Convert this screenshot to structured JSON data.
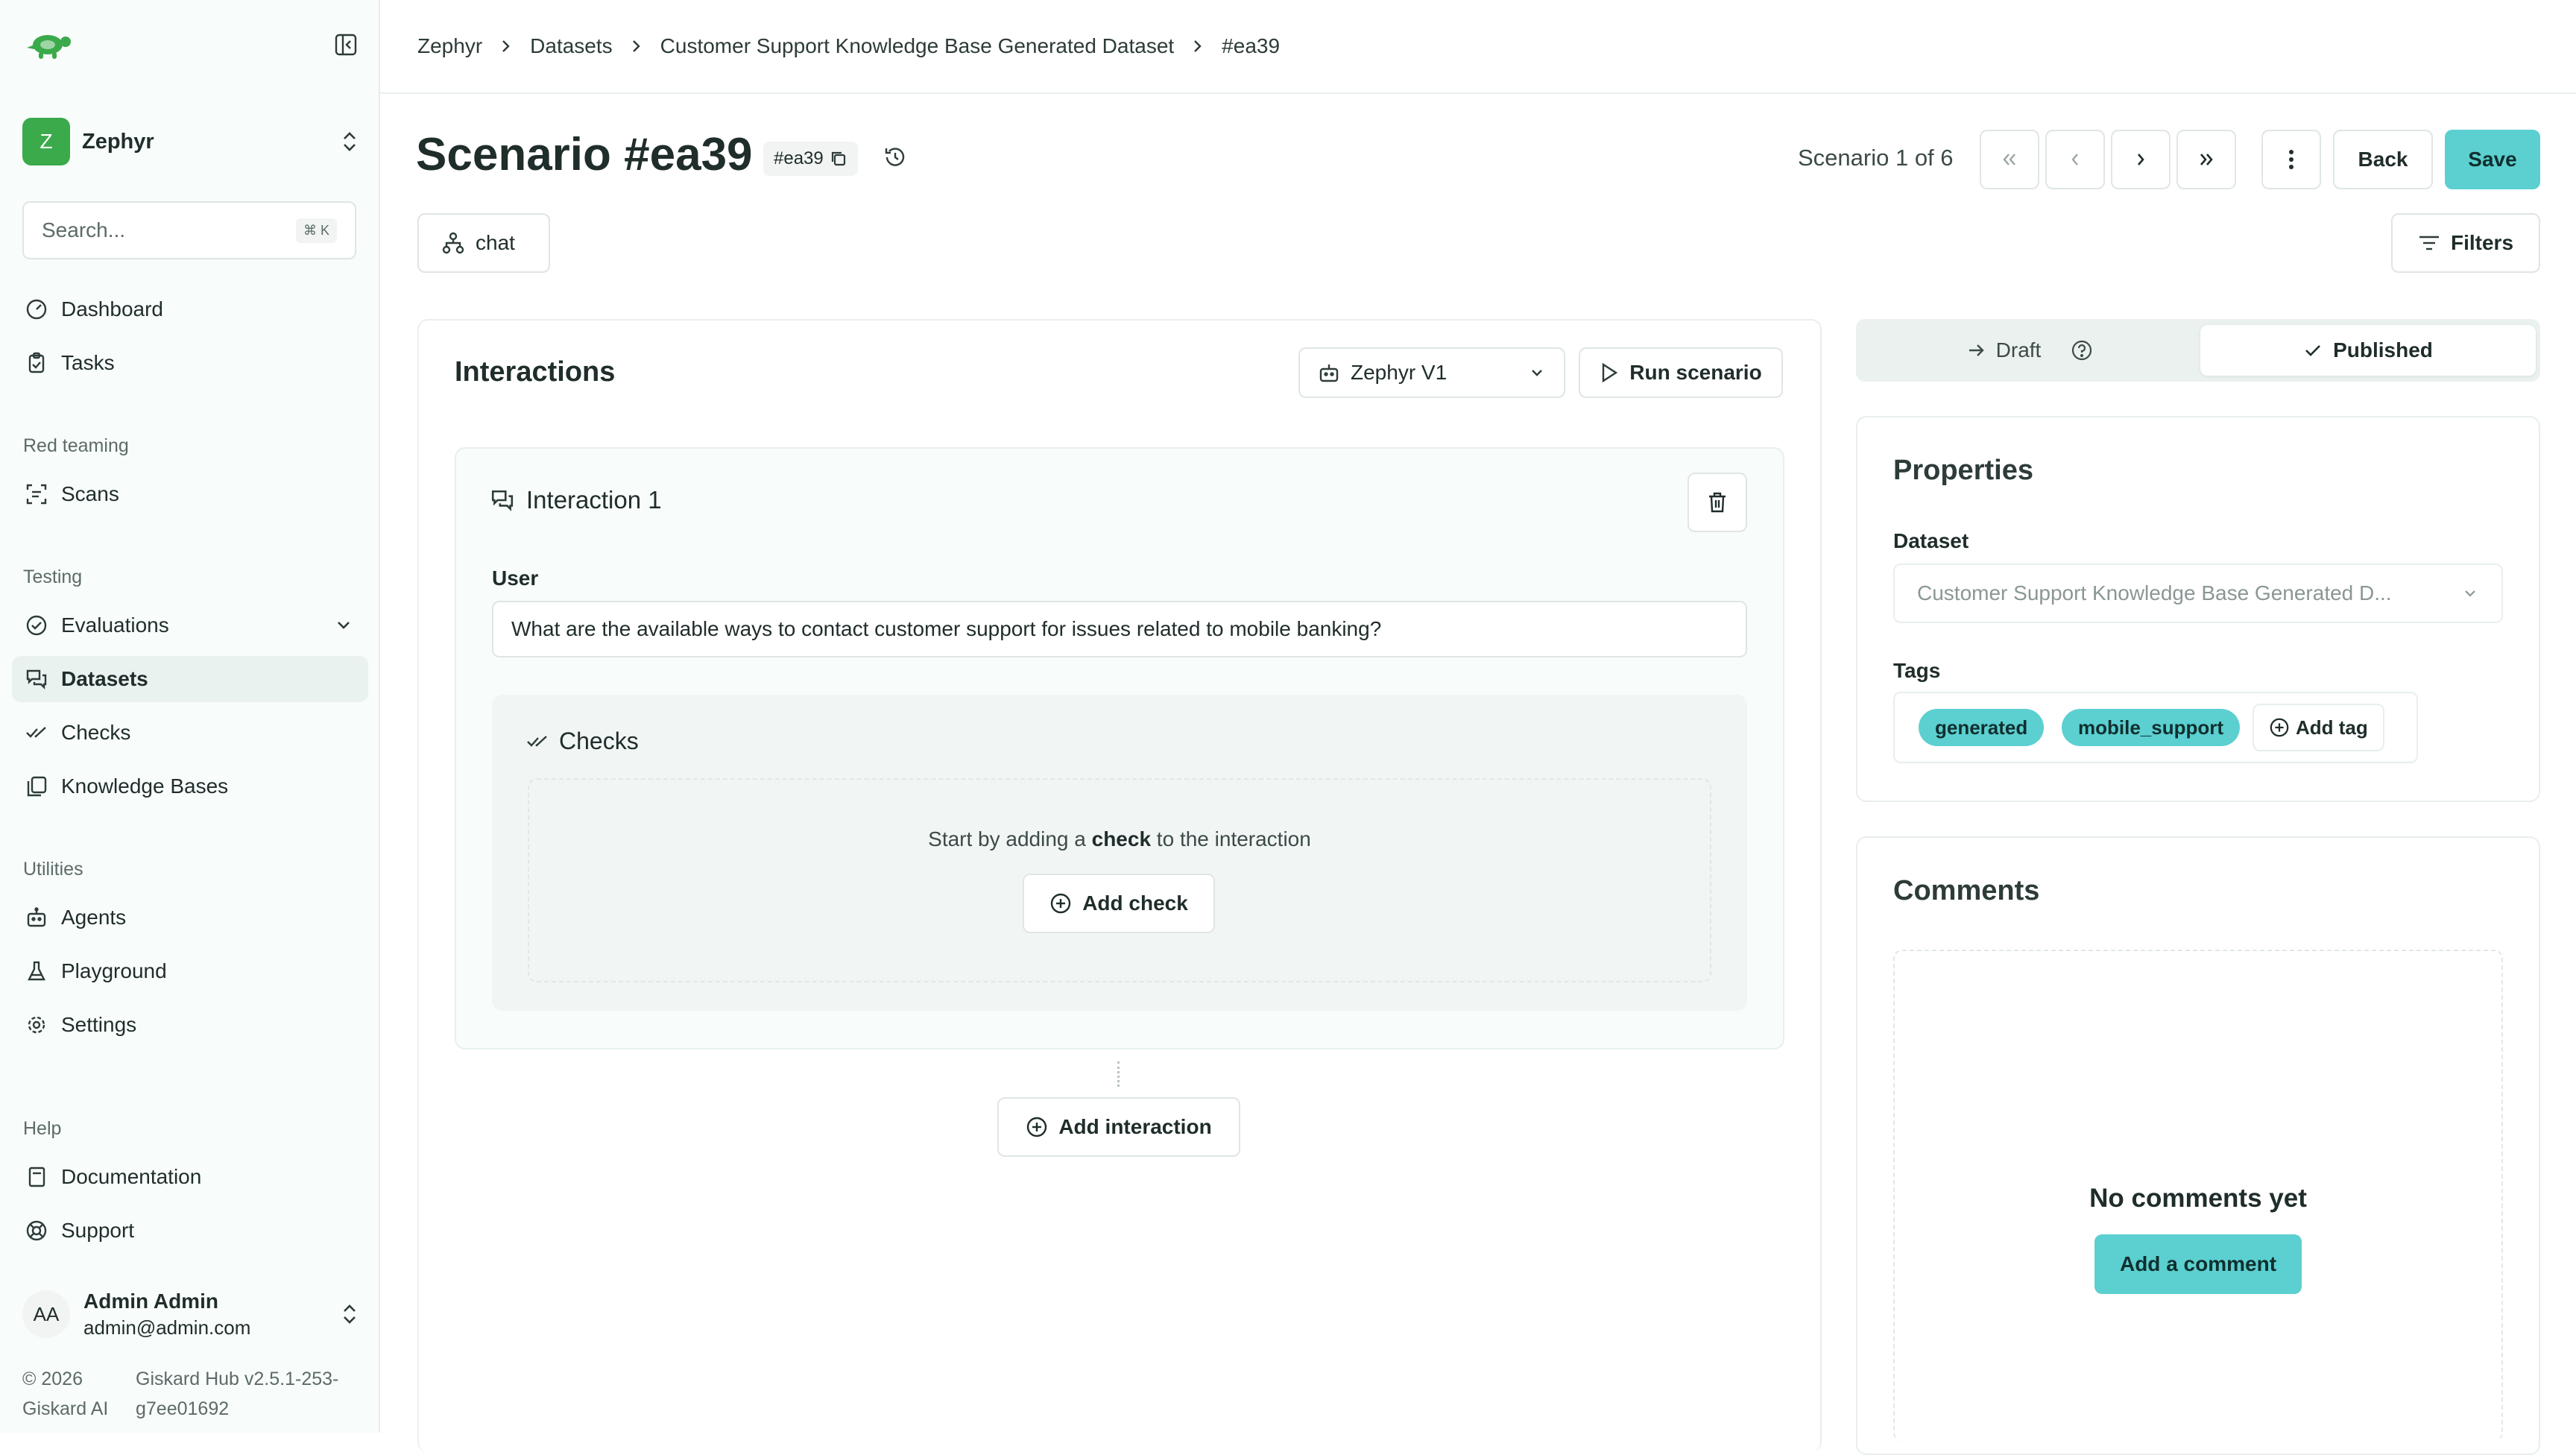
{
  "sidebar": {
    "org_initial": "Z",
    "org_name": "Zephyr",
    "search_placeholder": "Search...",
    "search_shortcut": "⌘ K",
    "items_top": [
      {
        "label": "Dashboard",
        "icon": "gauge-icon"
      },
      {
        "label": "Tasks",
        "icon": "clipboard-icon"
      }
    ],
    "section_red_teaming": "Red teaming",
    "scans_label": "Scans",
    "section_testing": "Testing",
    "evaluations_label": "Evaluations",
    "datasets_label": "Datasets",
    "checks_label": "Checks",
    "knowledge_bases_label": "Knowledge Bases",
    "section_utilities": "Utilities",
    "agents_label": "Agents",
    "playground_label": "Playground",
    "settings_label": "Settings",
    "section_help": "Help",
    "documentation_label": "Documentation",
    "support_label": "Support",
    "user_initials": "AA",
    "user_name": "Admin Admin",
    "user_email": "admin@admin.com",
    "copyright_line1": "© 2026",
    "copyright_line2": "Giskard AI",
    "version_line1": "Giskard Hub v2.5.1-253-",
    "version_line2": "g7ee01692"
  },
  "breadcrumb": {
    "items": [
      "Zephyr",
      "Datasets",
      "Customer Support Knowledge Base Generated Dataset",
      "#ea39"
    ]
  },
  "header": {
    "title": "Scenario #ea39",
    "id_badge": "#ea39",
    "scenario_counter": "Scenario 1 of 6",
    "back_label": "Back",
    "save_label": "Save",
    "chat_label": "chat",
    "filters_label": "Filters"
  },
  "interactions": {
    "title": "Interactions",
    "agent_select": "Zephyr V1",
    "run_label": "Run scenario",
    "interaction_title": "Interaction 1",
    "user_label": "User",
    "user_message": "What are the available ways to contact customer support for issues related to mobile banking?",
    "checks_title": "Checks",
    "empty_prefix": "Start by adding a ",
    "empty_bold": "check",
    "empty_suffix": " to the interaction",
    "add_check_label": "Add check",
    "add_interaction_label": "Add interaction"
  },
  "status": {
    "draft_label": "Draft",
    "published_label": "Published",
    "selected": "Published"
  },
  "properties": {
    "title": "Properties",
    "dataset_label": "Dataset",
    "dataset_value": "Customer Support Knowledge Base Generated D...",
    "tags_label": "Tags",
    "tags": [
      "generated",
      "mobile_support"
    ],
    "add_tag_label": "Add tag"
  },
  "comments": {
    "title": "Comments",
    "empty_text": "No comments yet",
    "add_label": "Add a comment"
  },
  "colors": {
    "accent": "#5ccfd0",
    "org_avatar": "#3aaa4a",
    "logo": "#3aaa4a"
  }
}
